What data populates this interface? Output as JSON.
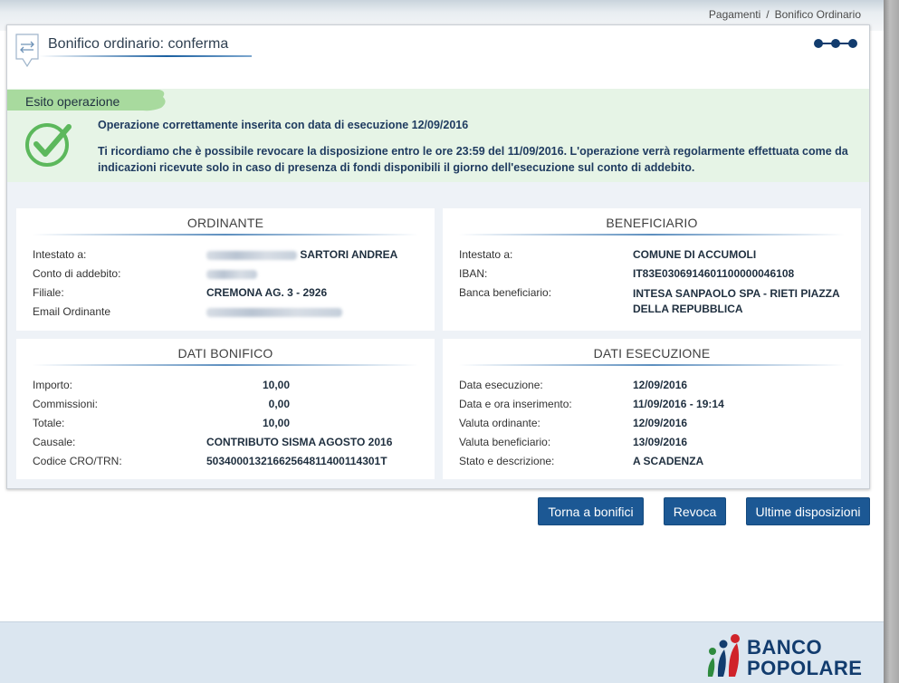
{
  "breadcrumb": {
    "item1": "Pagamenti",
    "separator": "/",
    "item2": "Bonifico Ordinario"
  },
  "header": {
    "title": "Bonifico ordinario: conferma",
    "icon": "exchange-icon"
  },
  "esito": {
    "tab_label": "Esito operazione",
    "message1": "Operazione correttamente inserita con data di esecuzione 12/09/2016",
    "message2": "Ti ricordiamo che è possibile revocare la disposizione entro le ore 23:59 del 11/09/2016. L'operazione verrà regolarmente effettuata come da indicazioni ricevute solo in caso di presenza di fondi disponibili il giorno dell'esecuzione sul conto di addebito.",
    "icon": "check-circle-icon"
  },
  "ordinante": {
    "title": "ORDINANTE",
    "intestato_label": "Intestato a:",
    "intestato_value": "SARTORI ANDREA",
    "conto_label": "Conto di addebito:",
    "filiale_label": "Filiale:",
    "filiale_value": "CREMONA AG. 3 - 2926",
    "email_label": "Email Ordinante"
  },
  "beneficiario": {
    "title": "BENEFICIARIO",
    "intestato_label": "Intestato a:",
    "intestato_value": "COMUNE DI ACCUMOLI",
    "iban_label": "IBAN:",
    "iban_value": "IT83E0306914601100000046108",
    "banca_label": "Banca beneficiario:",
    "banca_value_line1": "INTESA SANPAOLO SPA - RIETI PIAZZA",
    "banca_value_line2": "DELLA REPUBBLICA"
  },
  "dati_bonifico": {
    "title": "DATI BONIFICO",
    "importo_label": "Importo:",
    "importo_value": "10,00",
    "commissioni_label": "Commissioni:",
    "commissioni_value": "0,00",
    "totale_label": "Totale:",
    "totale_value": "10,00",
    "causale_label": "Causale:",
    "causale_value": "CONTRIBUTO SISMA AGOSTO 2016",
    "cro_label": "Codice CRO/TRN:",
    "cro_value": "50340001321662564811400114301T"
  },
  "dati_esecuzione": {
    "title": "DATI ESECUZIONE",
    "data_esecuzione_label": "Data esecuzione:",
    "data_esecuzione_value": "12/09/2016",
    "inserimento_label": "Data e ora inserimento:",
    "inserimento_value": "11/09/2016 - 19:14",
    "valuta_ord_label": "Valuta ordinante:",
    "valuta_ord_value": "12/09/2016",
    "valuta_ben_label": "Valuta beneficiario:",
    "valuta_ben_value": "13/09/2016",
    "stato_label": "Stato e descrizione:",
    "stato_value": "A SCADENZA"
  },
  "buttons": {
    "torna": "Torna a bonifici",
    "revoca": "Revoca",
    "ultime": "Ultime disposizioni"
  },
  "footer": {
    "logo_line1": "BANCO",
    "logo_line2": "POPOLARE"
  },
  "colors": {
    "primary": "#1c5894",
    "success": "#5cb85c",
    "success_bg": "#e6f4e6",
    "brand": "#123c6e"
  }
}
